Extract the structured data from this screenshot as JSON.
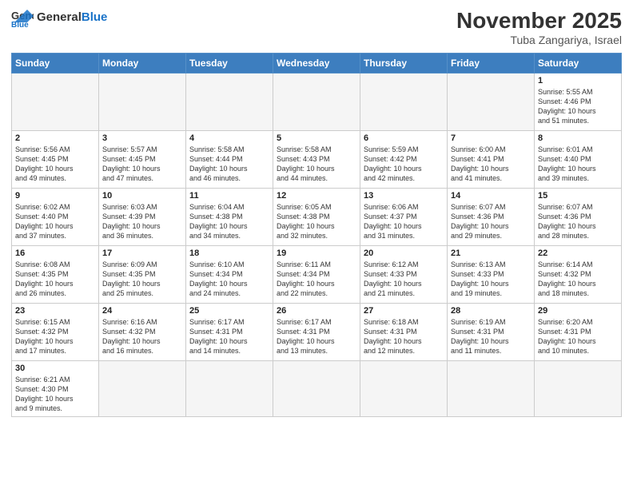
{
  "header": {
    "logo_general": "General",
    "logo_blue": "Blue",
    "month": "November 2025",
    "location": "Tuba Zangariya, Israel"
  },
  "weekdays": [
    "Sunday",
    "Monday",
    "Tuesday",
    "Wednesday",
    "Thursday",
    "Friday",
    "Saturday"
  ],
  "rows": [
    [
      {
        "day": "",
        "text": ""
      },
      {
        "day": "",
        "text": ""
      },
      {
        "day": "",
        "text": ""
      },
      {
        "day": "",
        "text": ""
      },
      {
        "day": "",
        "text": ""
      },
      {
        "day": "",
        "text": ""
      },
      {
        "day": "1",
        "text": "Sunrise: 5:55 AM\nSunset: 4:46 PM\nDaylight: 10 hours\nand 51 minutes."
      }
    ],
    [
      {
        "day": "2",
        "text": "Sunrise: 5:56 AM\nSunset: 4:45 PM\nDaylight: 10 hours\nand 49 minutes."
      },
      {
        "day": "3",
        "text": "Sunrise: 5:57 AM\nSunset: 4:45 PM\nDaylight: 10 hours\nand 47 minutes."
      },
      {
        "day": "4",
        "text": "Sunrise: 5:58 AM\nSunset: 4:44 PM\nDaylight: 10 hours\nand 46 minutes."
      },
      {
        "day": "5",
        "text": "Sunrise: 5:58 AM\nSunset: 4:43 PM\nDaylight: 10 hours\nand 44 minutes."
      },
      {
        "day": "6",
        "text": "Sunrise: 5:59 AM\nSunset: 4:42 PM\nDaylight: 10 hours\nand 42 minutes."
      },
      {
        "day": "7",
        "text": "Sunrise: 6:00 AM\nSunset: 4:41 PM\nDaylight: 10 hours\nand 41 minutes."
      },
      {
        "day": "8",
        "text": "Sunrise: 6:01 AM\nSunset: 4:40 PM\nDaylight: 10 hours\nand 39 minutes."
      }
    ],
    [
      {
        "day": "9",
        "text": "Sunrise: 6:02 AM\nSunset: 4:40 PM\nDaylight: 10 hours\nand 37 minutes."
      },
      {
        "day": "10",
        "text": "Sunrise: 6:03 AM\nSunset: 4:39 PM\nDaylight: 10 hours\nand 36 minutes."
      },
      {
        "day": "11",
        "text": "Sunrise: 6:04 AM\nSunset: 4:38 PM\nDaylight: 10 hours\nand 34 minutes."
      },
      {
        "day": "12",
        "text": "Sunrise: 6:05 AM\nSunset: 4:38 PM\nDaylight: 10 hours\nand 32 minutes."
      },
      {
        "day": "13",
        "text": "Sunrise: 6:06 AM\nSunset: 4:37 PM\nDaylight: 10 hours\nand 31 minutes."
      },
      {
        "day": "14",
        "text": "Sunrise: 6:07 AM\nSunset: 4:36 PM\nDaylight: 10 hours\nand 29 minutes."
      },
      {
        "day": "15",
        "text": "Sunrise: 6:07 AM\nSunset: 4:36 PM\nDaylight: 10 hours\nand 28 minutes."
      }
    ],
    [
      {
        "day": "16",
        "text": "Sunrise: 6:08 AM\nSunset: 4:35 PM\nDaylight: 10 hours\nand 26 minutes."
      },
      {
        "day": "17",
        "text": "Sunrise: 6:09 AM\nSunset: 4:35 PM\nDaylight: 10 hours\nand 25 minutes."
      },
      {
        "day": "18",
        "text": "Sunrise: 6:10 AM\nSunset: 4:34 PM\nDaylight: 10 hours\nand 24 minutes."
      },
      {
        "day": "19",
        "text": "Sunrise: 6:11 AM\nSunset: 4:34 PM\nDaylight: 10 hours\nand 22 minutes."
      },
      {
        "day": "20",
        "text": "Sunrise: 6:12 AM\nSunset: 4:33 PM\nDaylight: 10 hours\nand 21 minutes."
      },
      {
        "day": "21",
        "text": "Sunrise: 6:13 AM\nSunset: 4:33 PM\nDaylight: 10 hours\nand 19 minutes."
      },
      {
        "day": "22",
        "text": "Sunrise: 6:14 AM\nSunset: 4:32 PM\nDaylight: 10 hours\nand 18 minutes."
      }
    ],
    [
      {
        "day": "23",
        "text": "Sunrise: 6:15 AM\nSunset: 4:32 PM\nDaylight: 10 hours\nand 17 minutes."
      },
      {
        "day": "24",
        "text": "Sunrise: 6:16 AM\nSunset: 4:32 PM\nDaylight: 10 hours\nand 16 minutes."
      },
      {
        "day": "25",
        "text": "Sunrise: 6:17 AM\nSunset: 4:31 PM\nDaylight: 10 hours\nand 14 minutes."
      },
      {
        "day": "26",
        "text": "Sunrise: 6:17 AM\nSunset: 4:31 PM\nDaylight: 10 hours\nand 13 minutes."
      },
      {
        "day": "27",
        "text": "Sunrise: 6:18 AM\nSunset: 4:31 PM\nDaylight: 10 hours\nand 12 minutes."
      },
      {
        "day": "28",
        "text": "Sunrise: 6:19 AM\nSunset: 4:31 PM\nDaylight: 10 hours\nand 11 minutes."
      },
      {
        "day": "29",
        "text": "Sunrise: 6:20 AM\nSunset: 4:31 PM\nDaylight: 10 hours\nand 10 minutes."
      }
    ],
    [
      {
        "day": "30",
        "text": "Sunrise: 6:21 AM\nSunset: 4:30 PM\nDaylight: 10 hours\nand 9 minutes."
      },
      {
        "day": "",
        "text": ""
      },
      {
        "day": "",
        "text": ""
      },
      {
        "day": "",
        "text": ""
      },
      {
        "day": "",
        "text": ""
      },
      {
        "day": "",
        "text": ""
      },
      {
        "day": "",
        "text": ""
      }
    ]
  ]
}
